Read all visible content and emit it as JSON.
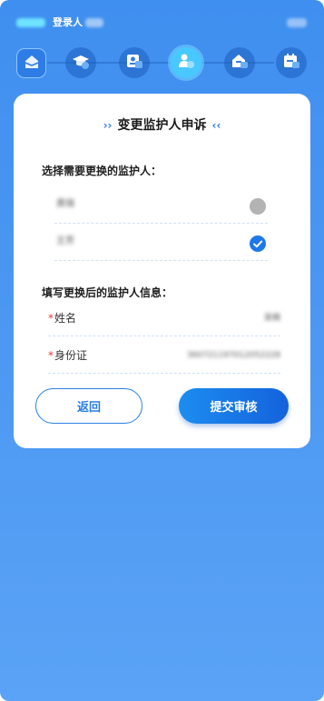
{
  "header": {
    "title": "登录人"
  },
  "steps": [
    {
      "icon": "home-icon"
    },
    {
      "icon": "graduation-cap-icon"
    },
    {
      "icon": "id-card-icon"
    },
    {
      "icon": "guardian-user-icon"
    },
    {
      "icon": "house-info-icon"
    },
    {
      "icon": "calendar-info-icon"
    }
  ],
  "card": {
    "title": "变更监护人申诉",
    "title_left_mark": "››",
    "title_right_mark": "‹‹",
    "select_label": "选择需要更换的监护人：",
    "guardians": [
      {
        "name": "黄瑞",
        "selected": false
      },
      {
        "name": "王芳",
        "selected": true
      }
    ],
    "fill_label": "填写更换后的监护人信息：",
    "fields": [
      {
        "label": "姓名",
        "required_mark": "*",
        "value": "吴楠"
      },
      {
        "label": "身份证",
        "required_mark": "*",
        "value": "360721197012052228"
      }
    ],
    "back_label": "返回",
    "submit_label": "提交审核"
  },
  "colors": {
    "background_top": "#3f8ff0",
    "background_bottom": "#5aa3f6",
    "accent": "#1e78e8",
    "required": "#e23b3b"
  }
}
